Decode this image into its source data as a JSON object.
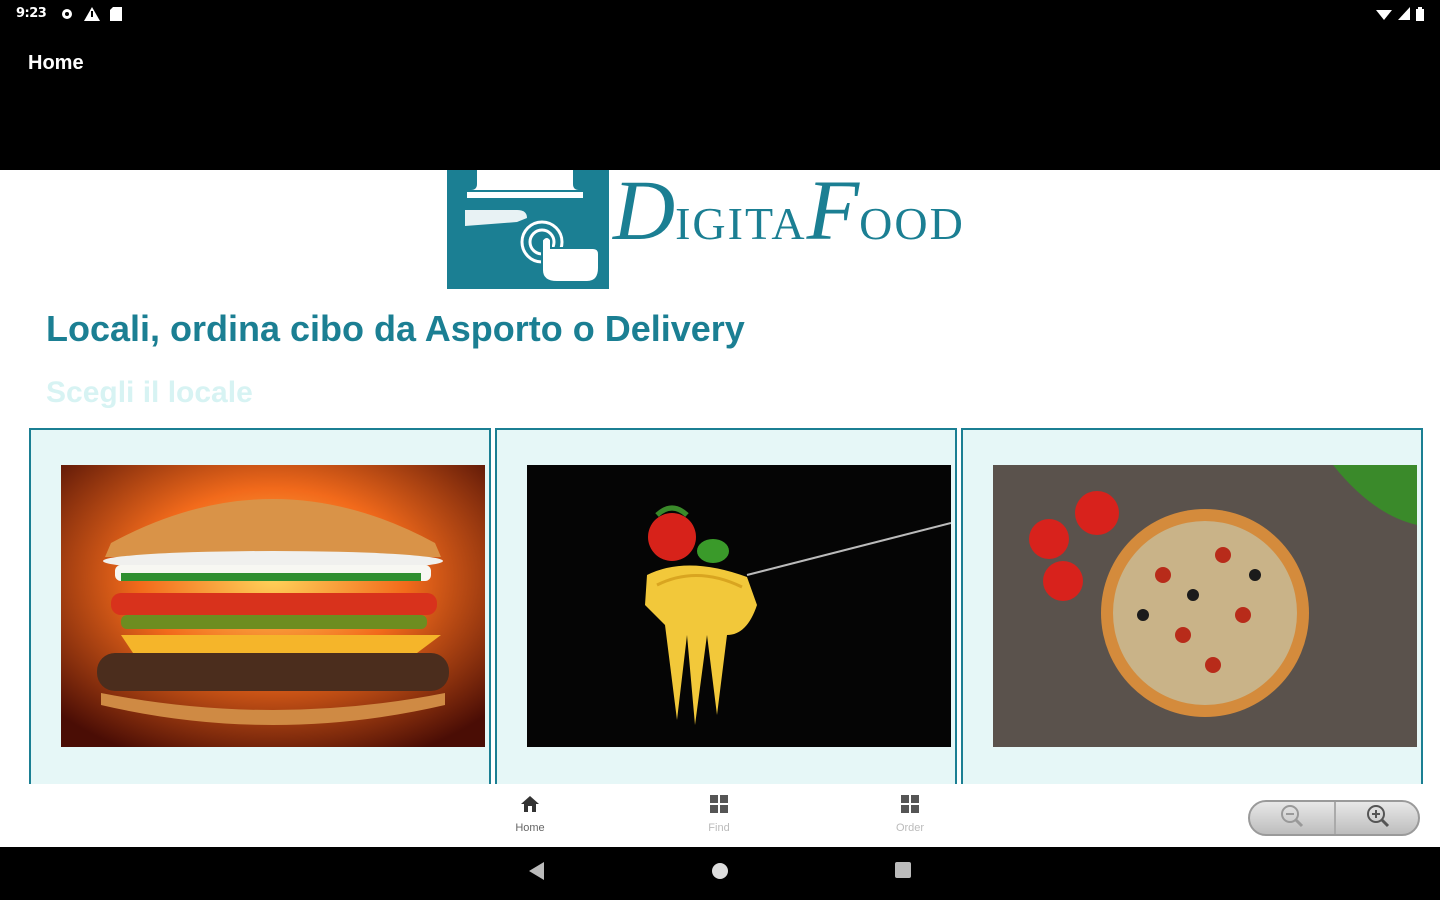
{
  "status_bar": {
    "time": "9:23",
    "left_icons": [
      "gear-icon",
      "warning-icon",
      "sd-card-icon"
    ],
    "right_icons": [
      "wifi-icon",
      "signal-icon",
      "battery-icon"
    ]
  },
  "app_bar": {
    "title": "Home"
  },
  "logo": {
    "first_cap": "D",
    "first_rest": "IGITA",
    "second_cap": "F",
    "second_rest": "OOD"
  },
  "headline": "Locali, ordina cibo da Asporto o Delivery",
  "subheadline": "Scegli il locale",
  "cards": [
    {
      "name": "burger",
      "image": "burger-image"
    },
    {
      "name": "pasta",
      "image": "pasta-image"
    },
    {
      "name": "pizza",
      "image": "pizza-image"
    }
  ],
  "bottom_nav": {
    "tabs": [
      {
        "label": "Home",
        "icon": "home-icon",
        "active": true
      },
      {
        "label": "Find",
        "icon": "grid-icon",
        "active": false
      },
      {
        "label": "Order",
        "icon": "grid-icon",
        "active": false
      }
    ]
  },
  "zoom_control": {
    "out_icon": "zoom-out-icon",
    "in_icon": "zoom-in-icon"
  },
  "colors": {
    "brand": "#1b7f93",
    "card_bg": "#e6f7f7",
    "subhead": "#d7f3f3"
  }
}
